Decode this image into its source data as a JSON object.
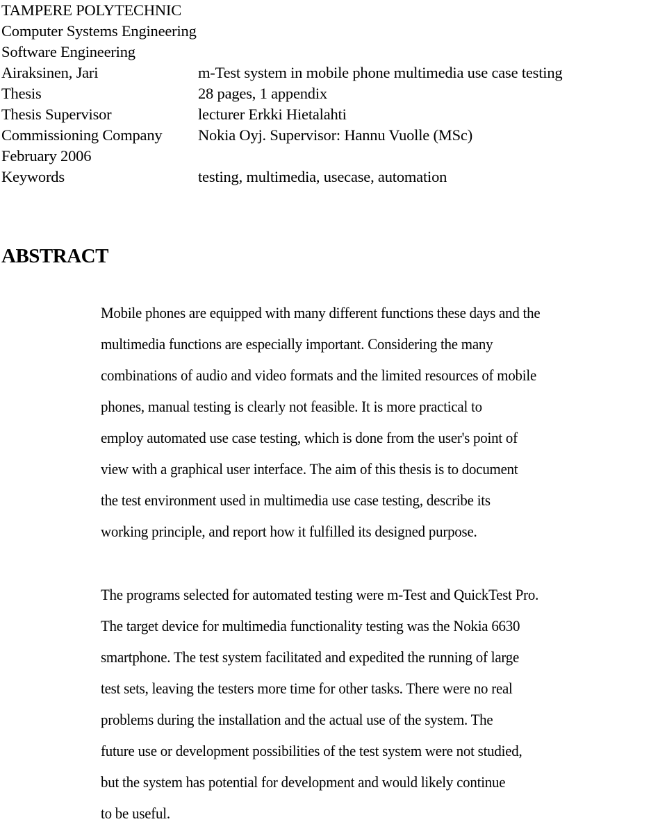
{
  "header": {
    "institution": "TAMPERE POLYTECHNIC",
    "degree_programme": "Computer Systems Engineering",
    "specialisation": "Software Engineering",
    "fields": [
      {
        "label": "Airaksinen, Jari",
        "value": "m-Test system in mobile phone multimedia use case testing"
      },
      {
        "label": "Thesis",
        "value": "28 pages, 1 appendix"
      },
      {
        "label": "Thesis Supervisor",
        "value": "lecturer Erkki Hietalahti"
      },
      {
        "label": "Commissioning Company",
        "value": "Nokia Oyj. Supervisor: Hannu Vuolle (MSc)"
      },
      {
        "label": "February 2006",
        "value": ""
      },
      {
        "label": "Keywords",
        "value": "testing, multimedia, usecase, automation"
      }
    ]
  },
  "abstract": {
    "title": "ABSTRACT",
    "paragraph1_lines": [
      "Mobile phones are equipped with many different functions these days and the",
      "multimedia functions are especially important. Considering the many",
      "combinations of audio and video formats and the limited resources of mobile",
      "phones, manual testing is clearly not feasible. It is more practical to",
      "employ automated use case testing, which is done from the user's point of",
      "view with a graphical user interface. The aim of this thesis is to document",
      "the test environment used in multimedia use case testing, describe its",
      "working principle, and report how it fulfilled its designed purpose."
    ],
    "paragraph2_lines": [
      "The programs selected for automated testing were m-Test and QuickTest Pro.",
      "The target device for multimedia functionality testing was the Nokia 6630",
      "smartphone. The test system facilitated and expedited the running of large",
      "test sets, leaving the testers more time for other tasks. There were no real",
      "problems during the installation and the actual use of the system. The",
      "future use or development possibilities of the test system were not studied,",
      "but the system has potential for development and would likely continue",
      "to be useful."
    ]
  }
}
